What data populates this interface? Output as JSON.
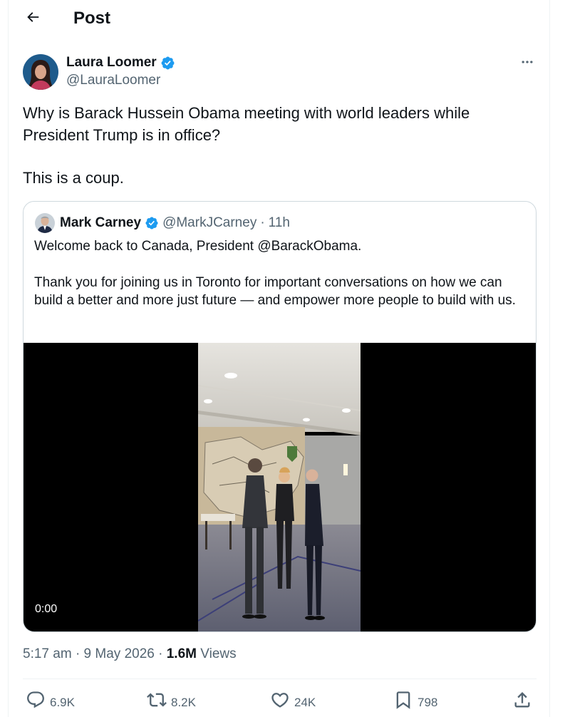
{
  "header": {
    "title": "Post",
    "back_icon": "arrow-left-icon"
  },
  "post": {
    "author": {
      "name": "Laura Loomer",
      "handle": "@LauraLoomer",
      "verified": true
    },
    "text_line1": "Why is Barack Hussein Obama meeting with world leaders while President Trump is in office?",
    "text_line2": "This is a coup.",
    "quote": {
      "author_name": "Mark Carney",
      "author_handle": "@MarkJCarney",
      "time_separator": "·",
      "time": "11h",
      "paragraph1": "Welcome back to Canada, President @BarackObama.",
      "paragraph2": "Thank you for joining us in Toronto for important conversations on how we can build a better and more just future — and empower more people to build with us.",
      "video_time": "0:00"
    },
    "time": "5:17 am",
    "dot": "·",
    "date": "9 May 2026",
    "views_count": "1.6M",
    "views_label": "Views"
  },
  "actions": {
    "replies": "6.9K",
    "reposts": "8.2K",
    "likes": "24K",
    "bookmarks": "798"
  },
  "colors": {
    "verified": "#1d9bf0",
    "secondary_text": "#536471",
    "primary_text": "#0f1419",
    "border": "#cfd9de"
  }
}
